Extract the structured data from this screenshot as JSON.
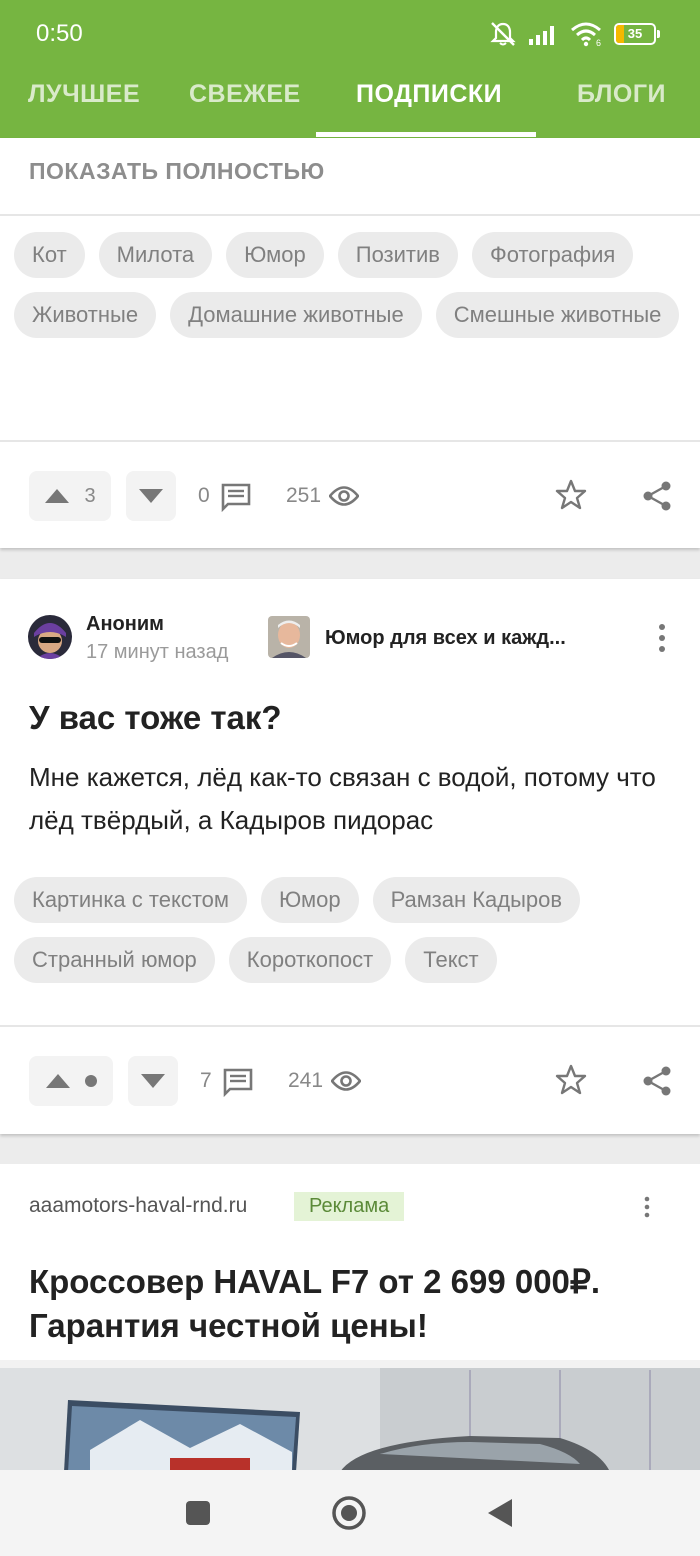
{
  "status_bar": {
    "time": "0:50",
    "battery": "35",
    "battery_level": 0.35
  },
  "tabs": [
    {
      "label": "ЛУЧШЕЕ"
    },
    {
      "label": "СВЕЖЕЕ"
    },
    {
      "label": "ПОДПИСКИ",
      "active": true
    },
    {
      "label": "БЛОГИ"
    }
  ],
  "post1": {
    "show_full_label": "ПОКАЗАТЬ ПОЛНОСТЬЮ",
    "tags": [
      "Кот",
      "Милота",
      "Юмор",
      "Позитив",
      "Фотография",
      "Животные",
      "Домашние животные",
      "Смешные животные"
    ],
    "upvotes": "3",
    "comments": "0",
    "views": "251"
  },
  "post2": {
    "author": "Аноним",
    "time_ago": "17 минут назад",
    "community": "Юмор для всех и кажд...",
    "title": "У вас тоже так?",
    "body": "Мне кажется, лёд как-то связан с водой, потому что лёд твёрдый, а Кадыров пидорас",
    "tags": [
      "Картинка с текстом",
      "Юмор",
      "Рамзан Кадыров",
      "Странный юмор",
      "Короткопост",
      "Текст"
    ],
    "comments": "7",
    "views": "241"
  },
  "ad": {
    "domain": "aaamotors-haval-rnd.ru",
    "badge": "Реклама",
    "title": "Кроссовер HAVAL F7 от 2 699 000₽. Гарантия честной цены!"
  },
  "colors": {
    "header": "#76b541",
    "tag_bg": "#ebebeb",
    "ad_badge_bg": "#e4f3d6"
  },
  "icons": [
    "mute-icon",
    "signal-icon",
    "wifi-icon",
    "battery-icon",
    "upvote-icon",
    "downvote-icon",
    "comment-icon",
    "eye-icon",
    "star-icon",
    "share-icon",
    "more-icon",
    "square-nav-icon",
    "home-nav-icon",
    "back-nav-icon"
  ]
}
